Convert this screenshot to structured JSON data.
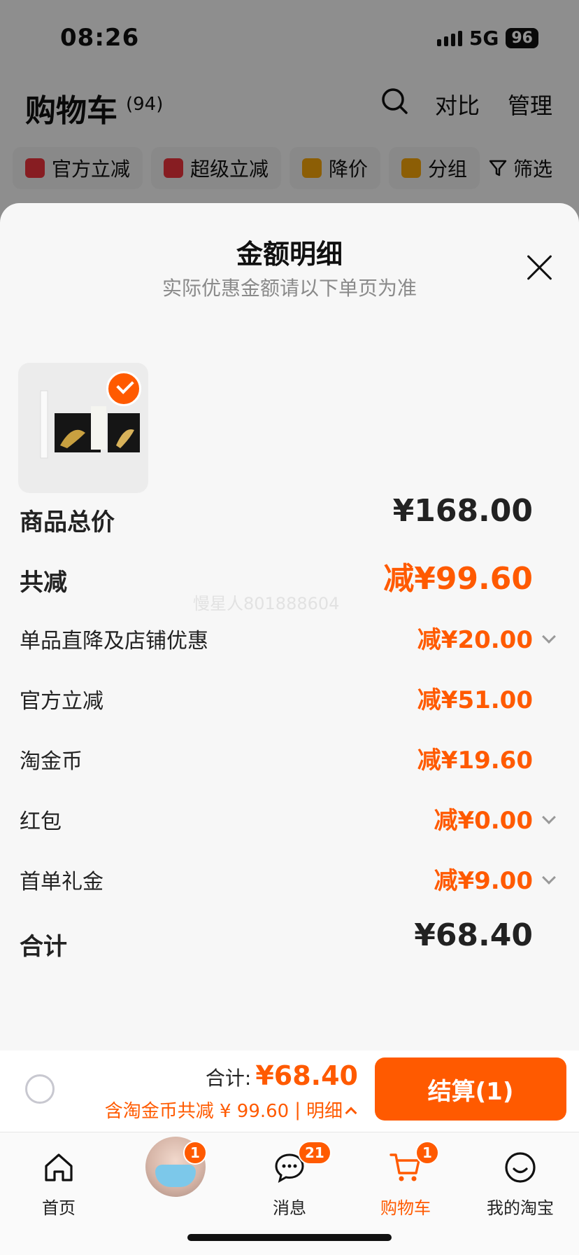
{
  "status_bar": {
    "time": "08:26",
    "network": "5G",
    "battery": "96"
  },
  "cart_header": {
    "title": "购物车",
    "count": "(94)",
    "compare": "对比",
    "manage": "管理"
  },
  "filters": [
    {
      "label": "官方立减",
      "color": "#e8323c"
    },
    {
      "label": "超级立减",
      "color": "#e8323c"
    },
    {
      "label": "降价",
      "color": "#f2a20a"
    },
    {
      "label": "分组",
      "color": "#f2a20a"
    }
  ],
  "filter_button": "筛选",
  "sheet": {
    "title": "金额明细",
    "subtitle": "实际优惠金额请以下单页为准",
    "watermark": "慢星人801888604"
  },
  "rows": [
    {
      "label": "商品总价",
      "value": "¥168.00",
      "bold": true,
      "kind": "black",
      "chevron": false
    },
    {
      "label": "共减",
      "value": "减¥99.60",
      "bold": true,
      "kind": "big",
      "chevron": false
    },
    {
      "label": "单品直降及店铺优惠",
      "value": "减¥20.00",
      "bold": false,
      "kind": "",
      "chevron": true
    },
    {
      "label": "官方立减",
      "value": "减¥51.00",
      "bold": false,
      "kind": "",
      "chevron": false
    },
    {
      "label": "淘金币",
      "value": "减¥19.60",
      "bold": false,
      "kind": "",
      "chevron": false
    },
    {
      "label": "红包",
      "value": "减¥0.00",
      "bold": false,
      "kind": "",
      "chevron": true
    },
    {
      "label": "首单礼金",
      "value": "减¥9.00",
      "bold": false,
      "kind": "",
      "chevron": true
    },
    {
      "label": "合计",
      "value": "¥68.40",
      "bold": true,
      "kind": "black",
      "chevron": false
    }
  ],
  "checkout": {
    "total_label": "合计:",
    "total_amount": "¥68.40",
    "savings": "含淘金币共减 ¥ 99.60",
    "separator": "|",
    "details": "明细",
    "button": "结算(1)"
  },
  "tabbar": {
    "home": "首页",
    "avatar_badge": "1",
    "messages": "消息",
    "messages_badge": "21",
    "cart": "购物车",
    "cart_badge": "1",
    "mine": "我的淘宝"
  },
  "colors": {
    "accent": "#ff5a00"
  }
}
